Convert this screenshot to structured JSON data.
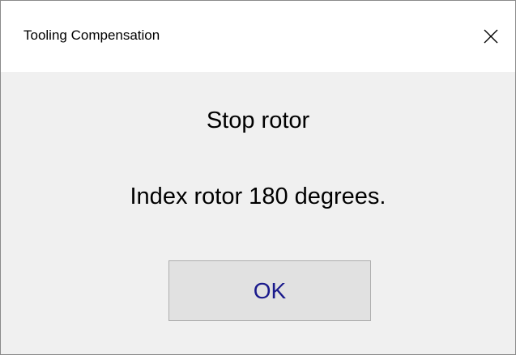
{
  "window": {
    "title": "Tooling Compensation",
    "close_icon": "close-icon"
  },
  "dialog": {
    "line1": "Stop rotor",
    "line2": "Index rotor 180 degrees.",
    "ok_label": "OK"
  },
  "colors": {
    "titlebar_bg": "#ffffff",
    "client_bg": "#f0f0f0",
    "button_bg": "#e1e1e1",
    "button_text": "#1a1a8c"
  }
}
